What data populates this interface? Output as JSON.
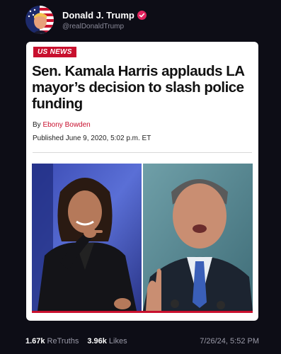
{
  "post": {
    "author": {
      "display_name": "Donald J. Trump",
      "handle": "@realDonaldTrump",
      "verified_icon": "verified-badge-icon",
      "avatar_icon": "avatar"
    },
    "article": {
      "source_badge": "US NEWS",
      "headline": "Sen. Kamala Harris applauds LA mayor’s decision to slash police funding",
      "byline_prefix": "By",
      "author": "Ebony Bowden",
      "published": "Published June 9, 2020, 5:02 p.m. ET",
      "left_image": "photo of woman pointing",
      "right_image": "photo of man speaking"
    },
    "stats": {
      "retruths_count": "1.67k",
      "retruths_label": "ReTruths",
      "likes_count": "3.96k",
      "likes_label": "Likes",
      "timestamp": "7/26/24, 5:52 PM"
    },
    "colors": {
      "background": "#0d0d16",
      "accent_red": "#c8102e",
      "verified_pink": "#e0245e"
    }
  }
}
